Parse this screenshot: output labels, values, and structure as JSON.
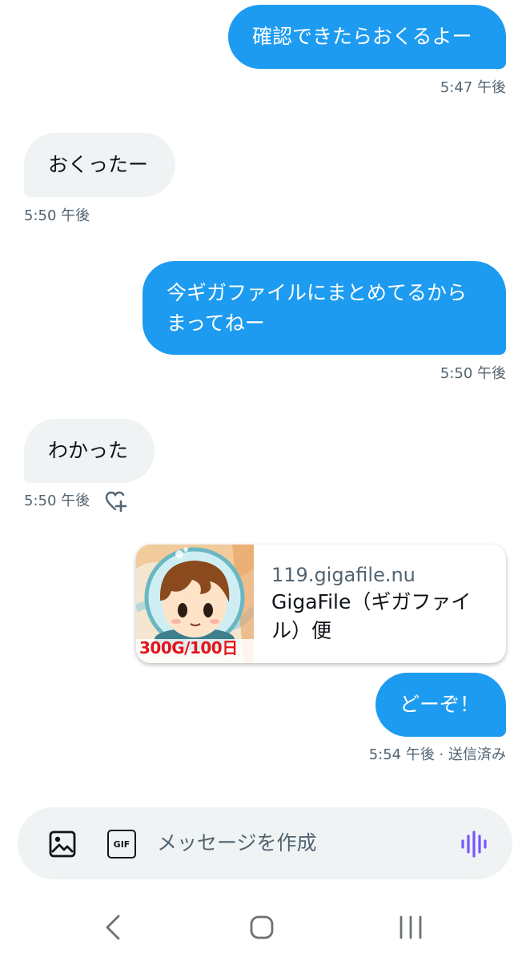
{
  "messages": [
    {
      "direction": "sent",
      "text": "確認できたらおくるよー",
      "time": "5:47 午後"
    },
    {
      "direction": "received",
      "text": "おくったー",
      "time": "5:50 午後"
    },
    {
      "direction": "sent",
      "lines": [
        "今ギガファイルにまとめてるから",
        "まってねー"
      ],
      "time": "5:50 午後"
    },
    {
      "direction": "received",
      "text": "わかった",
      "time": "5:50 午後"
    },
    {
      "direction": "sent",
      "text": "どーぞ！",
      "time": "5:54 午後 · 送信済み"
    }
  ],
  "link_card": {
    "domain": "119.gigafile.nu",
    "title": "GigaFile（ギガファイル）便",
    "thumbnail_caption": "300G/100日"
  },
  "composer": {
    "placeholder": "メッセージを作成",
    "image_icon": "image-icon",
    "gif_label": "GIF",
    "voice_icon": "voice-waveform-icon"
  },
  "colors": {
    "sent_bubble": "#1d9bf0",
    "received_bubble": "#eff3f4",
    "timestamp": "#536471",
    "voice_icon": "#7856ff"
  },
  "nav": {
    "back_icon": "back-icon",
    "home_icon": "home-icon",
    "recents_icon": "recents-icon"
  }
}
